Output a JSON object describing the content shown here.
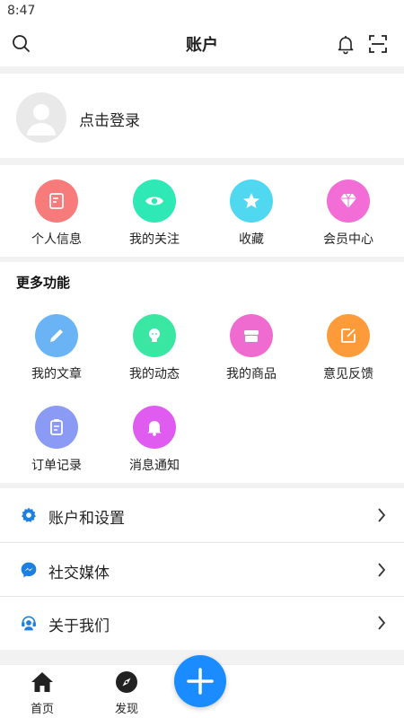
{
  "status_bar": {
    "time": "8:47"
  },
  "header": {
    "title": "账户"
  },
  "login": {
    "text": "点击登录"
  },
  "quick": [
    {
      "label": "个人信息",
      "color": "#f77b7b",
      "icon": "profile-edit-icon"
    },
    {
      "label": "我的关注",
      "color": "#2ee8b6",
      "icon": "eye-icon"
    },
    {
      "label": "收藏",
      "color": "#4fd8f0",
      "icon": "star-icon"
    },
    {
      "label": "会员中心",
      "color": "#f26dd6",
      "icon": "diamond-icon"
    }
  ],
  "more": {
    "title": "更多功能",
    "items": [
      {
        "label": "我的文章",
        "color": "#6ab4f5",
        "icon": "pencil-icon"
      },
      {
        "label": "我的动态",
        "color": "#39e6a2",
        "icon": "lightbulb-icon"
      },
      {
        "label": "我的商品",
        "color": "#f06bd0",
        "icon": "box-icon"
      },
      {
        "label": "意见反馈",
        "color": "#fd9a3a",
        "icon": "feedback-edit-icon"
      },
      {
        "label": "订单记录",
        "color": "#8b9bf5",
        "icon": "clipboard-icon"
      },
      {
        "label": "消息通知",
        "color": "#e05cf0",
        "icon": "bell-icon"
      }
    ]
  },
  "list": [
    {
      "label": "账户和设置",
      "icon": "gear-icon",
      "color": "#1d7fe0"
    },
    {
      "label": "社交媒体",
      "icon": "messenger-icon",
      "color": "#1d7fe0"
    },
    {
      "label": "关于我们",
      "icon": "support-agent-icon",
      "color": "#1d7fe0"
    }
  ],
  "tabbar": {
    "home": "首页",
    "discover": "发现"
  }
}
